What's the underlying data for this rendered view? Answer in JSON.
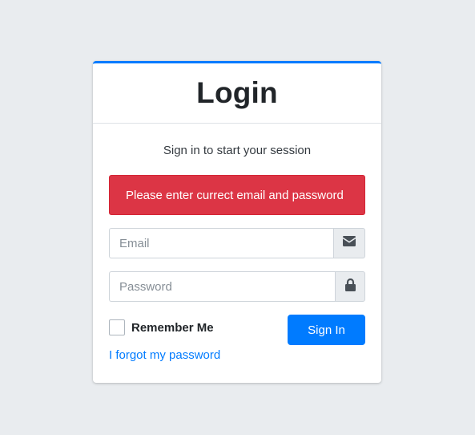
{
  "header": {
    "title": "Login"
  },
  "body": {
    "message": "Sign in to start your session",
    "alert": "Please enter currect email and password"
  },
  "form": {
    "email": {
      "value": "",
      "placeholder": "Email",
      "icon": "envelope-icon"
    },
    "password": {
      "value": "",
      "placeholder": "Password",
      "icon": "lock-icon"
    },
    "remember_label": "Remember Me",
    "remember_checked": false,
    "signin_label": "Sign In",
    "forgot_link": "I forgot my password"
  },
  "colors": {
    "primary": "#007bff",
    "danger": "#dc3545",
    "background": "#e9ecef"
  }
}
